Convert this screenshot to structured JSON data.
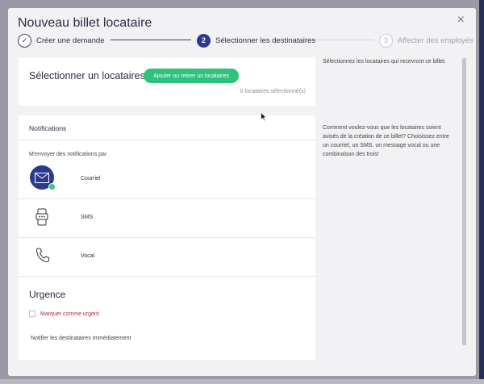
{
  "modal": {
    "title": "Nouveau billet locataire",
    "close_glyph": "×"
  },
  "stepper": {
    "steps": [
      {
        "number": "✓",
        "label": "Créer une demande",
        "state": "done"
      },
      {
        "number": "2",
        "label": "Sélectionner les destinataires",
        "state": "active"
      },
      {
        "number": "3",
        "label": "Affecter des employés",
        "state": "pending"
      }
    ]
  },
  "recipients": {
    "title": "Sélectionner un locataires",
    "add_button": "Ajouter ou retirer un locataires",
    "count_text": "0 locataires sélectionné(s)"
  },
  "notifications": {
    "title": "Notifications",
    "subtitle": "M'envoyer des notifications par",
    "options": [
      {
        "label": "Courriel",
        "icon": "envelope-icon",
        "selected": true
      },
      {
        "label": "SMS",
        "icon": "sms-phone-icon",
        "selected": false
      },
      {
        "label": "Vocal",
        "icon": "phone-icon",
        "selected": false
      }
    ]
  },
  "urgence": {
    "title": "Urgence",
    "checkbox_label": "Marquer comme urgent",
    "description": "Notifier les destinataires immédiatement"
  },
  "sidebar": {
    "recipients_help": "Sélectionnez les locataires qui recevront ce billet.",
    "notifications_help": "Comment voulez-vous que les locataires soient avisés de la création de ce billet? Choisissez entre un courriel, un SMS, un message vocal ou une combinaison des trois!"
  },
  "colors": {
    "primary": "#2b3a8c",
    "accent_green": "#2ec27e",
    "urgent_red": "#b0283e"
  }
}
